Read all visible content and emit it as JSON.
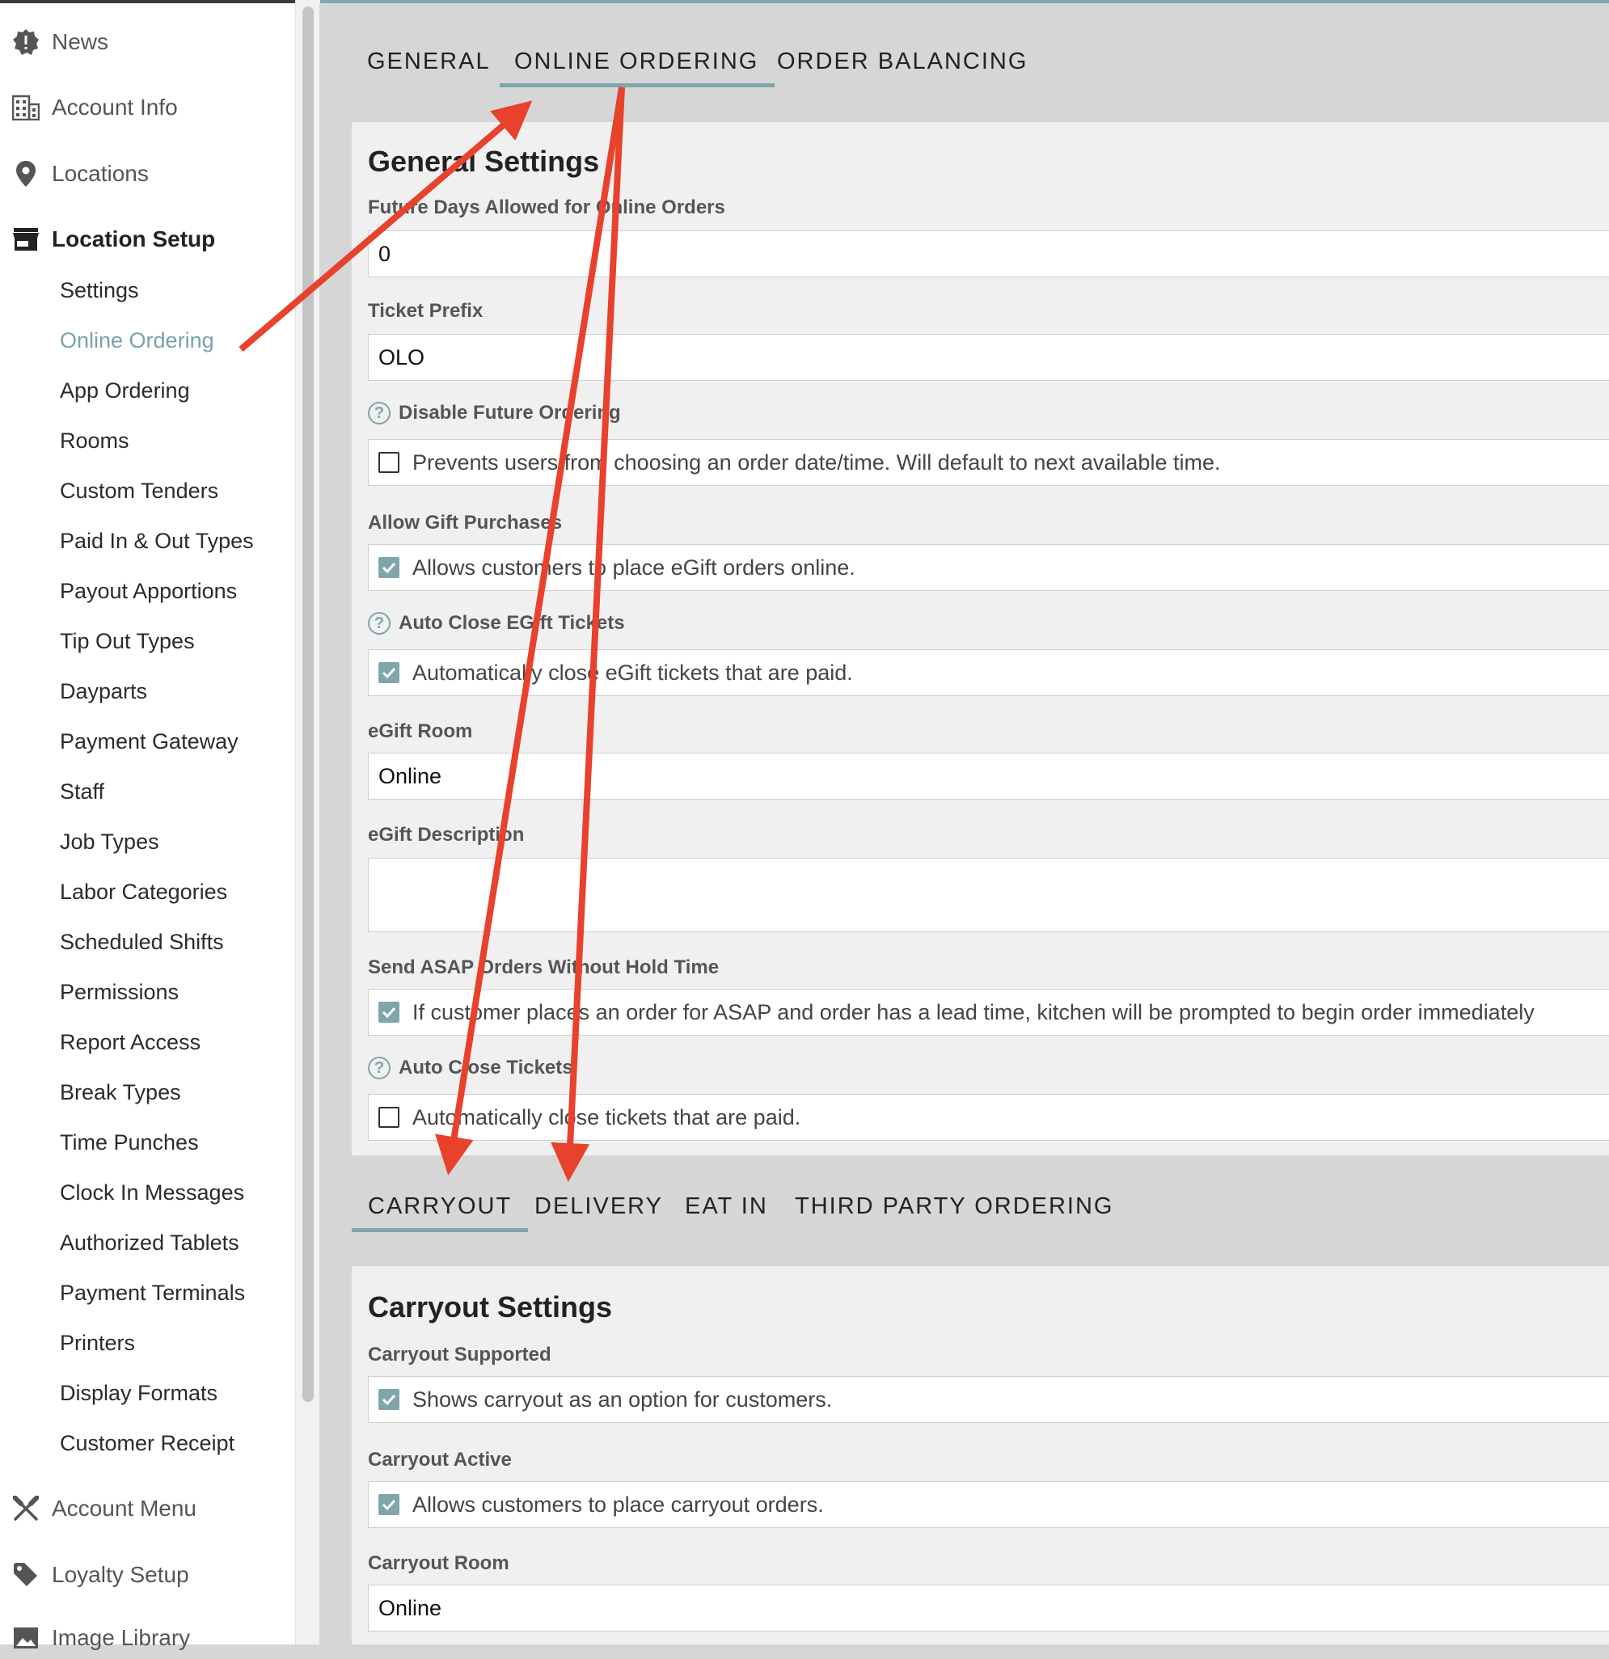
{
  "sidebar": {
    "top_items": [
      {
        "label": "News",
        "icon": "news-badge-icon"
      },
      {
        "label": "Account Info",
        "icon": "building-icon"
      },
      {
        "label": "Locations",
        "icon": "map-pin-icon"
      },
      {
        "label": "Location Setup",
        "icon": "store-icon"
      }
    ],
    "sub_items": [
      "Settings",
      "Online Ordering",
      "App Ordering",
      "Rooms",
      "Custom Tenders",
      "Paid In & Out Types",
      "Payout Apportions",
      "Tip Out Types",
      "Dayparts",
      "Payment Gateway",
      "Staff",
      "Job Types",
      "Labor Categories",
      "Scheduled Shifts",
      "Permissions",
      "Report Access",
      "Break Types",
      "Time Punches",
      "Clock In Messages",
      "Authorized Tablets",
      "Payment Terminals",
      "Printers",
      "Display Formats",
      "Customer Receipt"
    ],
    "bottom_items": [
      {
        "label": "Account Menu",
        "icon": "utensils-icon"
      },
      {
        "label": "Loyalty Setup",
        "icon": "tag-icon"
      },
      {
        "label": "Image Library",
        "icon": "image-icon"
      }
    ],
    "active_sub": "Online Ordering"
  },
  "top_tabs": [
    "GENERAL",
    "ONLINE ORDERING",
    "ORDER BALANCING"
  ],
  "general": {
    "title": "General Settings",
    "future_days_label": "Future Days Allowed for Online Orders",
    "future_days_value": "0",
    "ticket_prefix_label": "Ticket Prefix",
    "ticket_prefix_value": "OLO",
    "disable_future_label": "Disable Future Ordering",
    "disable_future_text": "Prevents users from choosing an order date/time. Will default to next available time.",
    "gift_label": "Allow Gift Purchases",
    "gift_text": "Allows customers to place eGift orders online.",
    "autoclose_egift_label": "Auto Close EGift Tickets",
    "autoclose_egift_text": "Automatically close eGift tickets that are paid.",
    "egift_room_label": "eGift Room",
    "egift_room_value": "Online",
    "egift_desc_label": "eGift Description",
    "egift_desc_value": "",
    "asap_label": "Send ASAP Orders Without Hold Time",
    "asap_text": "If customer places an order for ASAP and order has a lead time, kitchen will be prompted to begin order immediately",
    "autoclose_label": "Auto Close Tickets",
    "autoclose_text": "Automatically close tickets that are paid."
  },
  "sub_tabs": [
    "CARRYOUT",
    "DELIVERY",
    "EAT IN",
    "THIRD PARTY ORDERING"
  ],
  "carryout": {
    "title": "Carryout Settings",
    "supported_label": "Carryout Supported",
    "supported_text": "Shows carryout as an option for customers.",
    "active_label": "Carryout Active",
    "active_text": "Allows customers to place carryout orders.",
    "room_label": "Carryout Room",
    "room_value": "Online"
  },
  "checkbox_states": {
    "disable_future": false,
    "gift": true,
    "autoclose_egift": true,
    "asap": true,
    "autoclose": false,
    "carryout_supported": true,
    "carryout_active": true
  },
  "colors": {
    "accent": "#7fa6ab",
    "arrow": "#e8412c"
  }
}
